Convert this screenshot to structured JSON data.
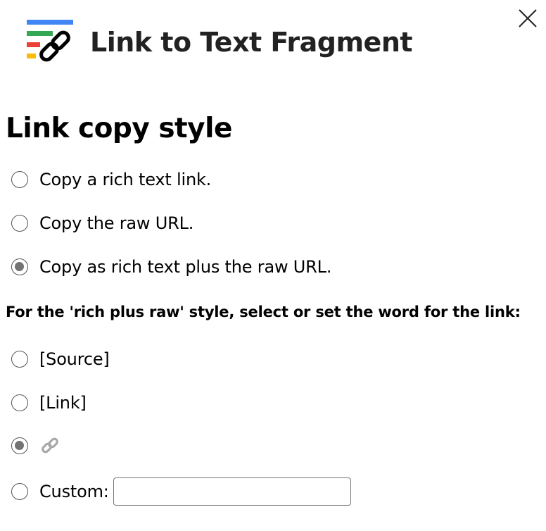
{
  "app": {
    "title": "Link to Text Fragment",
    "logo_icon": "link-fragment-logo"
  },
  "close_icon": "close-icon",
  "copy_style": {
    "heading": "Link copy style",
    "options": [
      {
        "label": "Copy a rich text link.",
        "checked": false
      },
      {
        "label": "Copy the raw URL.",
        "checked": false
      },
      {
        "label": "Copy as rich text plus the raw URL.",
        "checked": true
      }
    ]
  },
  "link_word": {
    "heading": "For the 'rich plus raw' style, select or set the word for the link:",
    "options": [
      {
        "label": "[Source]",
        "checked": false
      },
      {
        "label": "[Link]",
        "checked": false
      },
      {
        "label": "",
        "icon": "link-icon",
        "checked": true
      },
      {
        "label": "Custom:",
        "checked": false
      }
    ],
    "custom_value": ""
  },
  "colors": {
    "logo_blue": "#4285F4",
    "logo_green": "#34A853",
    "logo_red": "#EA4335",
    "logo_yellow": "#FBBC05",
    "radio_checked": "#737373"
  }
}
